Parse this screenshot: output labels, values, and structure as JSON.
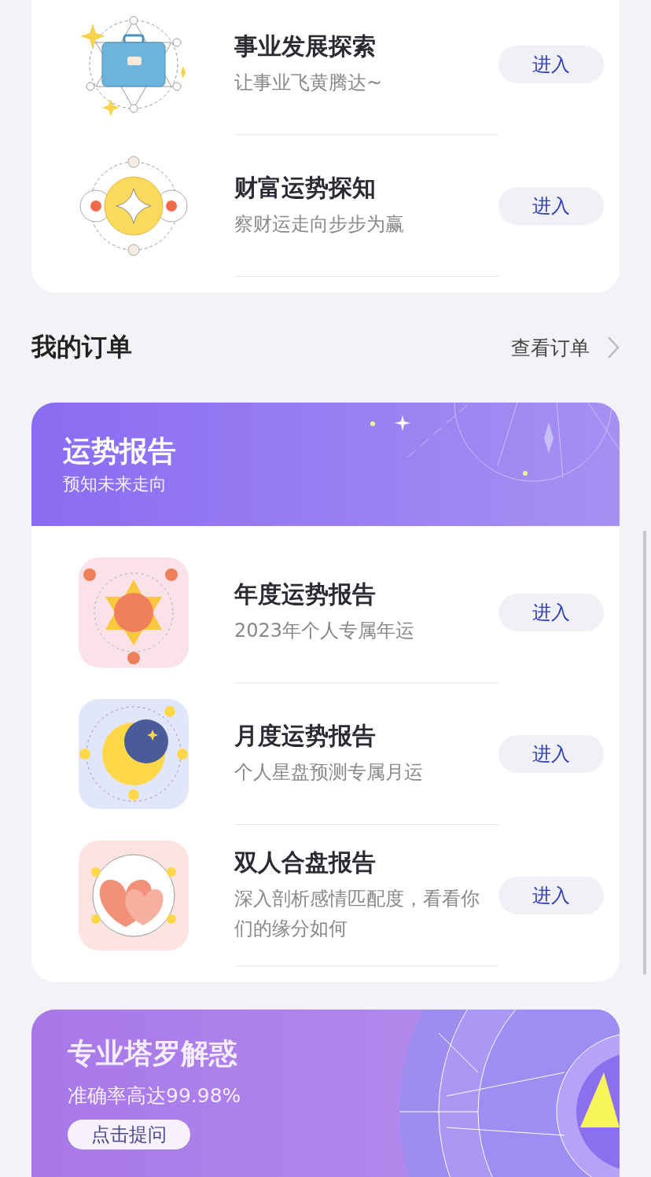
{
  "top_card": {
    "rows": [
      {
        "kind": "briefcase",
        "title": "事业发展探索",
        "subtitle": "让事业飞黄腾达~",
        "button": "进入"
      },
      {
        "kind": "coin",
        "title": "财富运势探知",
        "subtitle": "察财运走向步步为赢",
        "button": "进入"
      }
    ]
  },
  "orders": {
    "title": "我的订单",
    "link": "查看订单"
  },
  "report_card": {
    "title": "运势报告",
    "subtitle": "预知未来走向",
    "rows": [
      {
        "kind": "sun",
        "title": "年度运势报告",
        "subtitle": "2023年个人专属年运",
        "button": "进入"
      },
      {
        "kind": "moon",
        "title": "月度运势报告",
        "subtitle": "个人星盘预测专属月运",
        "button": "进入"
      },
      {
        "kind": "hearts",
        "title": "双人合盘报告",
        "subtitle": "深入剖析感情匹配度，看看你们的缘分如何",
        "button": "进入"
      }
    ]
  },
  "tarot_banner": {
    "title": "专业塔罗解惑",
    "subtitle": "准确率高达99.98%",
    "button": "点击提问"
  }
}
